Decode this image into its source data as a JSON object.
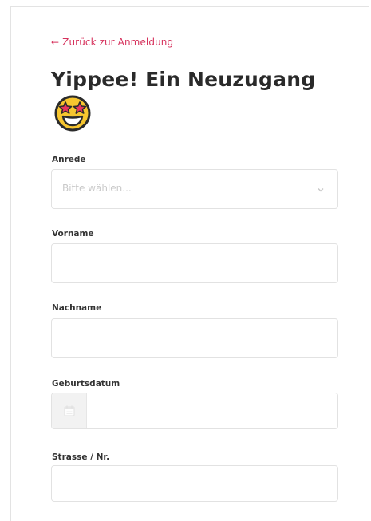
{
  "nav": {
    "back_arrow": "←",
    "back_label": "Zurück zur Anmeldung"
  },
  "header": {
    "title": "Yippee! Ein Neuzugang",
    "emoji_icon": "star-struck-emoji-icon"
  },
  "form": {
    "salutation": {
      "label": "Anrede",
      "placeholder": "Bitte wählen..."
    },
    "first_name": {
      "label": "Vorname",
      "value": ""
    },
    "last_name": {
      "label": "Nachname",
      "value": ""
    },
    "birth_date": {
      "label": "Geburtsdatum",
      "value": "",
      "icon": "calendar-icon"
    },
    "street": {
      "label": "Strasse / Nr.",
      "value": ""
    }
  },
  "colors": {
    "accent": "#d6315c",
    "text": "#2a2a2a",
    "border": "#e2e2e2",
    "placeholder": "#c9c9c9"
  }
}
